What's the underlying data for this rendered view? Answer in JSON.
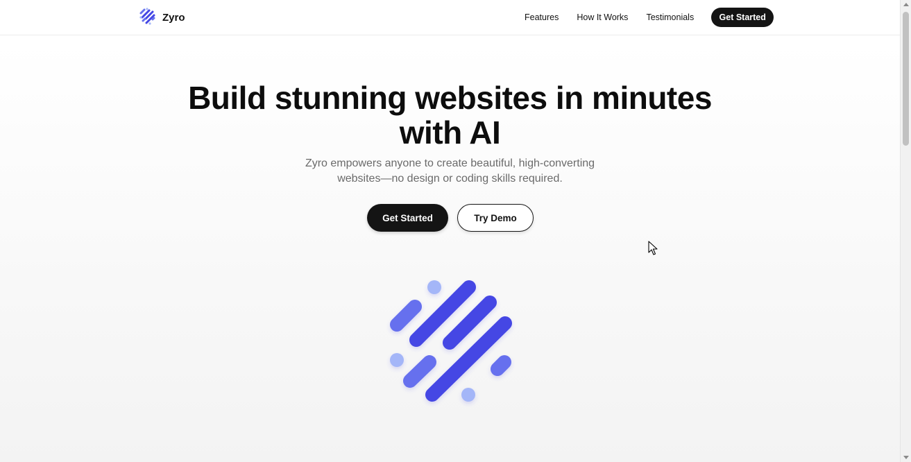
{
  "header": {
    "brand_name": "Zyro",
    "logo_icon": "zyro-stripes-logo-icon",
    "nav": [
      {
        "label": "Features"
      },
      {
        "label": "How It Works"
      },
      {
        "label": "Testimonials"
      }
    ],
    "cta_label": "Get Started"
  },
  "hero": {
    "title_line1": "Build stunning websites in minutes",
    "title_line2": "with AI",
    "subtitle": "Zyro empowers anyone to create beautiful, high-converting websites—no design or coding skills required.",
    "primary_cta": "Get Started",
    "secondary_cta": "Try Demo",
    "illustration_icon": "zyro-stripes-illustration-icon"
  },
  "colors": {
    "accent_dark": "#4446e4",
    "accent_mid": "#6670ee",
    "accent_light": "#a4b6f8",
    "button_dark": "#141414"
  }
}
